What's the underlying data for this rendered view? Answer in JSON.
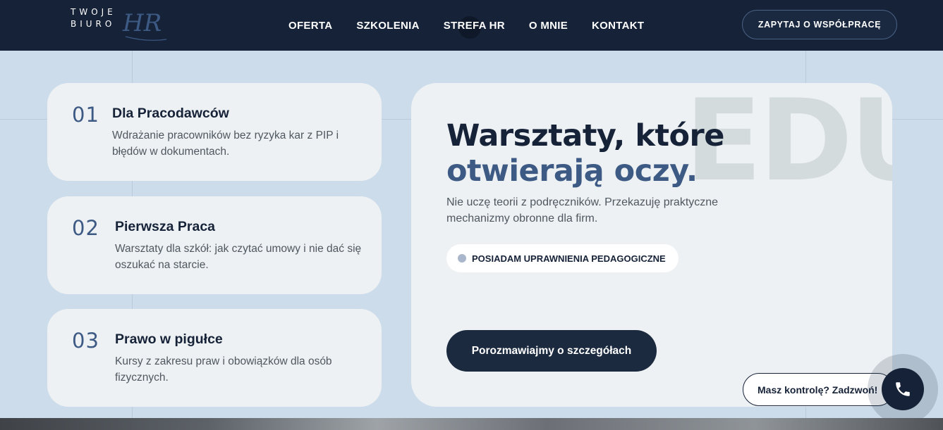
{
  "header": {
    "logo": {
      "line1": "TWOJE",
      "line2": "BIURO",
      "monogram": "HR"
    },
    "nav": [
      "OFERTA",
      "SZKOLENIA",
      "STREFA HR",
      "O MNIE",
      "KONTAKT"
    ],
    "cta_label": "ZAPYTAJ O WSPÓŁPRACĘ"
  },
  "cards": [
    {
      "num": "01",
      "title": "Dla Pracodawców",
      "desc": "Wdrażanie pracowników bez ryzyka kar z PIP i błędów w dokumentach."
    },
    {
      "num": "02",
      "title": "Pierwsza Praca",
      "desc": "Warsztaty dla szkół: jak czytać umowy i nie dać się oszukać na starcie."
    },
    {
      "num": "03",
      "title": "Prawo w pigułce",
      "desc": "Kursy z zakresu praw i obowiązków dla osób fizycznych."
    }
  ],
  "hero": {
    "bg_word": "EDU",
    "title_line1": "Warsztaty, które",
    "title_line2": "otwierają oczy.",
    "desc": "Nie uczę teorii z podręczników. Przekazuję praktyczne mechanizmy obronne dla firm.",
    "badge": "POSIADAM UPRAWNIENIA PEDAGOGICZNE",
    "button_label": "Porozmawiajmy o szczegółach"
  },
  "call": {
    "label": "Masz kontrolę? Zadzwoń!",
    "icon": "phone-icon"
  },
  "colors": {
    "navy": "#162238",
    "accent": "#3d5a84",
    "card": "#edf1f3",
    "page": "#ccdcea"
  }
}
